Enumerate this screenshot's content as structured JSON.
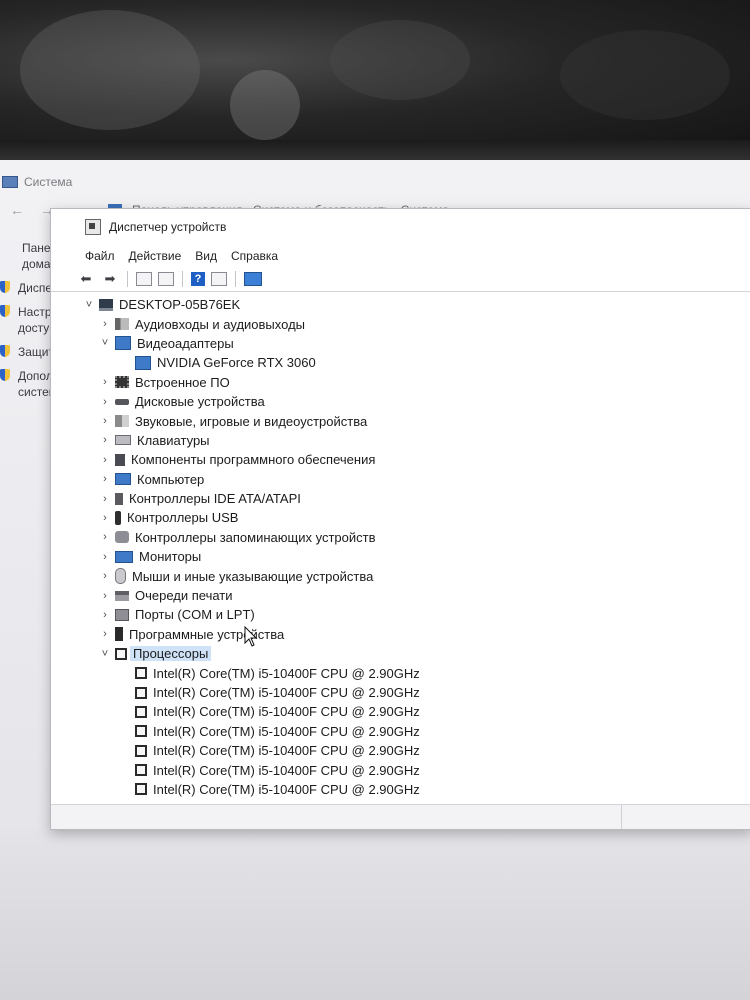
{
  "background_window": {
    "title": "Система",
    "address": "Панель управления  ›  Система и безопасность  ›  Система",
    "sidebar": [
      {
        "text": "Панель у домашн",
        "shield": false
      },
      {
        "text": "Диспетче",
        "shield": true
      },
      {
        "text": "Настройк доступа",
        "shield": true
      },
      {
        "text": "Защита с",
        "shield": true
      },
      {
        "text": "Дополни системы",
        "shield": true
      }
    ]
  },
  "device_manager": {
    "title": "Диспетчер устройств",
    "menu": [
      "Файл",
      "Действие",
      "Вид",
      "Справка"
    ],
    "toolbar_icons": [
      "back-icon",
      "forward-icon",
      "properties-icon",
      "view-icon",
      "help-icon",
      "update-icon",
      "scan-hardware-icon"
    ],
    "computer_name": "DESKTOP-05B76EK",
    "tree": [
      {
        "label": "Аудиовходы и аудиовыходы",
        "icon": "audio-icon",
        "expanded": false,
        "children": []
      },
      {
        "label": "Видеоадаптеры",
        "icon": "video-adapter-icon",
        "expanded": true,
        "children": [
          "NVIDIA GeForce RTX 3060"
        ]
      },
      {
        "label": "Встроенное ПО",
        "icon": "firmware-icon",
        "expanded": false,
        "children": []
      },
      {
        "label": "Дисковые устройства",
        "icon": "disk-icon",
        "expanded": false,
        "children": []
      },
      {
        "label": "Звуковые, игровые и видеоустройства",
        "icon": "sound-icon",
        "expanded": false,
        "children": []
      },
      {
        "label": "Клавиатуры",
        "icon": "keyboard-icon",
        "expanded": false,
        "children": []
      },
      {
        "label": "Компоненты программного обеспечения",
        "icon": "software-component-icon",
        "expanded": false,
        "children": []
      },
      {
        "label": "Компьютер",
        "icon": "computer-icon",
        "expanded": false,
        "children": []
      },
      {
        "label": "Контроллеры IDE ATA/ATAPI",
        "icon": "ide-controller-icon",
        "expanded": false,
        "children": []
      },
      {
        "label": "Контроллеры USB",
        "icon": "usb-icon",
        "expanded": false,
        "children": []
      },
      {
        "label": "Контроллеры запоминающих устройств",
        "icon": "storage-controller-icon",
        "expanded": false,
        "children": []
      },
      {
        "label": "Мониторы",
        "icon": "monitor-icon",
        "expanded": false,
        "children": []
      },
      {
        "label": "Мыши и иные указывающие устройства",
        "icon": "mouse-icon",
        "expanded": false,
        "children": []
      },
      {
        "label": "Очереди печати",
        "icon": "printer-icon",
        "expanded": false,
        "children": []
      },
      {
        "label": "Порты (COM и LPT)",
        "icon": "port-icon",
        "expanded": false,
        "children": []
      },
      {
        "label": "Программные устройства",
        "icon": "software-device-icon",
        "expanded": false,
        "children": []
      },
      {
        "label": "Процессоры",
        "icon": "processor-icon",
        "expanded": true,
        "selected": true,
        "children": [
          "Intel(R) Core(TM) i5-10400F CPU @ 2.90GHz",
          "Intel(R) Core(TM) i5-10400F CPU @ 2.90GHz",
          "Intel(R) Core(TM) i5-10400F CPU @ 2.90GHz",
          "Intel(R) Core(TM) i5-10400F CPU @ 2.90GHz",
          "Intel(R) Core(TM) i5-10400F CPU @ 2.90GHz",
          "Intel(R) Core(TM) i5-10400F CPU @ 2.90GHz",
          "Intel(R) Core(TM) i5-10400F CPU @ 2.90GHz"
        ]
      }
    ]
  }
}
